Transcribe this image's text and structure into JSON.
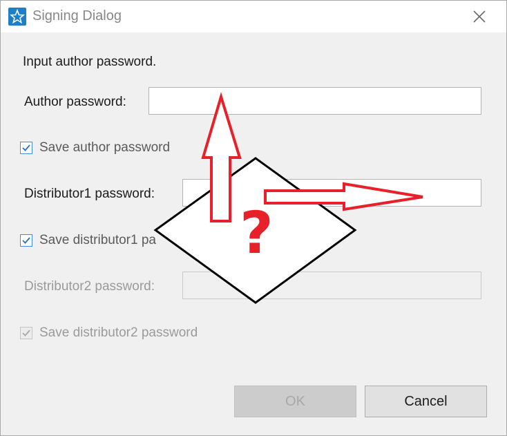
{
  "window": {
    "title": "Signing Dialog",
    "icon": "star-app-icon",
    "close_icon": "close-icon"
  },
  "form": {
    "instruction": "Input author password.",
    "author_password_label": "Author password:",
    "author_password_value": "",
    "save_author_label": "Save author password",
    "save_author_checked": true,
    "distributor1_password_label": "Distributor1 password:",
    "distributor1_password_value": "",
    "save_distributor1_label": "Save distributor1 pa",
    "save_distributor1_checked": true,
    "distributor2_password_label": "Distributor2 password:",
    "distributor2_password_value": "",
    "distributor2_enabled": false,
    "save_distributor2_label": "Save distributor2 password",
    "save_distributor2_checked": true,
    "save_distributor2_enabled": false
  },
  "buttons": {
    "ok_label": "OK",
    "ok_enabled": false,
    "cancel_label": "Cancel"
  },
  "overlay": {
    "question_mark": "?",
    "arrow_color": "#e8202a",
    "diamond_color": "#000000"
  },
  "colors": {
    "accent": "#3e8ed8",
    "titlebar": "#ffffff",
    "background": "#f0f0f0"
  }
}
